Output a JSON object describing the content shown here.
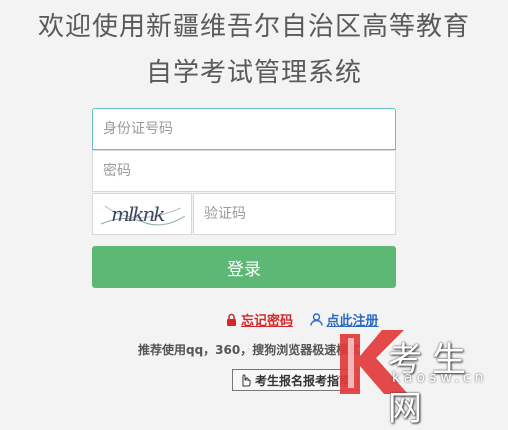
{
  "header": {
    "title_line1": "欢迎使用新疆维吾尔自治区高等教育",
    "title_line2": "自学考试管理系统"
  },
  "form": {
    "id_placeholder": "身份证号码",
    "password_placeholder": "密码",
    "captcha_placeholder": "验证码",
    "captcha_text": "mlknk",
    "login_label": "登录"
  },
  "links": {
    "forgot_password": "忘记密码",
    "register": "点此注册"
  },
  "footer": {
    "recommend": "推荐使用qq，360，搜狗浏览器极速模式",
    "guide": "考生报名报考指南"
  },
  "watermark": {
    "brand": "考生网",
    "url": "kaosw.cn"
  },
  "colors": {
    "login_button": "#5cb874",
    "forgot_link": "#d6282b",
    "register_link": "#2d6bc2",
    "input_focus_border": "#66c0c6"
  },
  "icons": [
    "lock-icon",
    "user-icon",
    "hand-pointer-icon"
  ]
}
